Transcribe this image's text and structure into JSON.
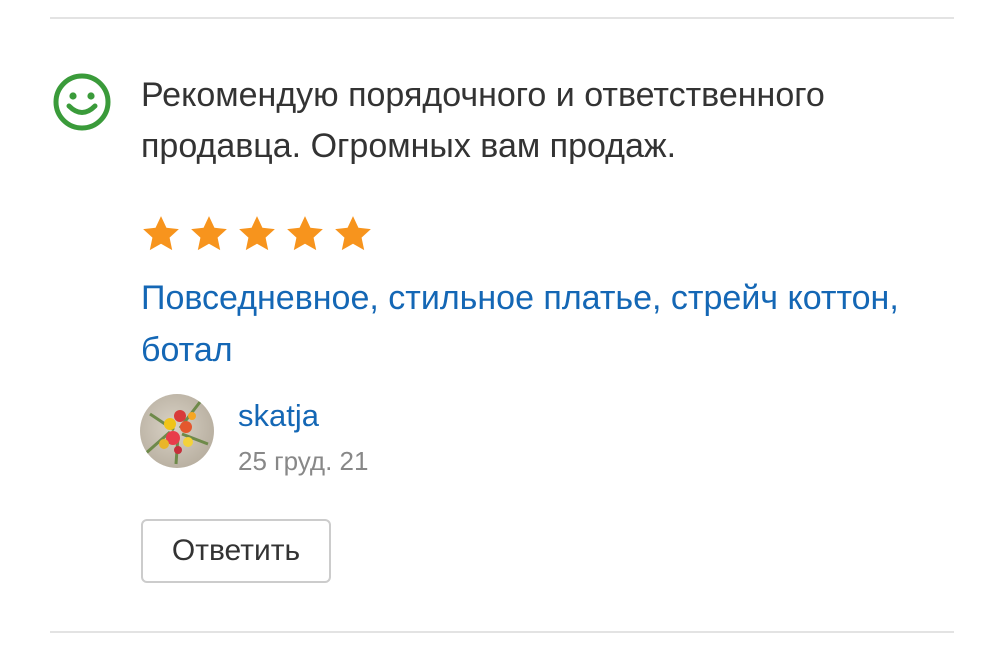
{
  "review": {
    "sentiment_icon": "smiley-icon",
    "sentiment_color": "#3a9b3a",
    "text": "Рекомендую порядочного и ответственного продавца. Огромных вам продаж.",
    "rating": 5,
    "rating_max": 5,
    "star_color": "#f7941d",
    "product_link": "Повседневное, стильное платье, стрейч коттон, ботал",
    "author": {
      "name": "skatja",
      "avatar_icon": "avatar-flowers-image"
    },
    "date": "25 груд. 21",
    "reply_label": "Ответить"
  },
  "colors": {
    "link": "#1467b5",
    "text": "#333333",
    "muted": "#888888",
    "divider": "#e3e3e3"
  }
}
